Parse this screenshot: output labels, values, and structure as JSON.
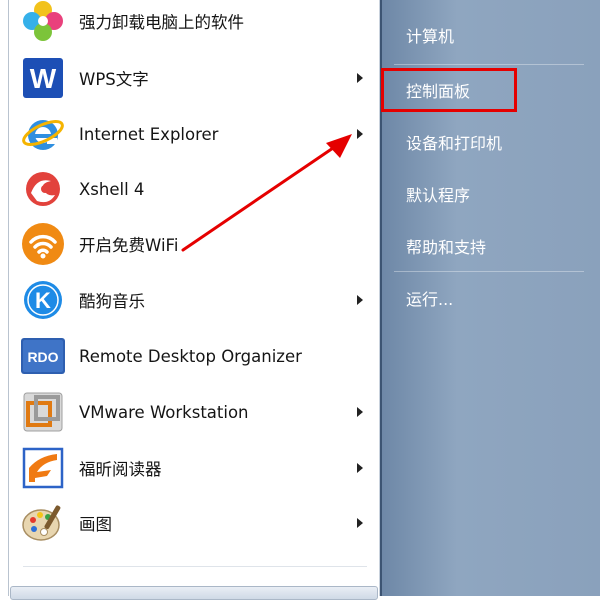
{
  "programs": [
    {
      "label": "强力卸载电脑上的软件",
      "icon": "uninstaller-icon",
      "has_submenu": false
    },
    {
      "label": "WPS文字",
      "icon": "wps-writer-icon",
      "has_submenu": true
    },
    {
      "label": "Internet Explorer",
      "icon": "internet-explorer-icon",
      "has_submenu": true
    },
    {
      "label": "Xshell 4",
      "icon": "xshell-icon",
      "has_submenu": false
    },
    {
      "label": "开启免费WiFi",
      "icon": "free-wifi-icon",
      "has_submenu": false
    },
    {
      "label": "酷狗音乐",
      "icon": "kugou-music-icon",
      "has_submenu": true
    },
    {
      "label": "Remote Desktop Organizer",
      "icon": "rdo-icon",
      "has_submenu": false
    },
    {
      "label": "VMware Workstation",
      "icon": "vmware-icon",
      "has_submenu": true
    },
    {
      "label": "福昕阅读器",
      "icon": "foxit-reader-icon",
      "has_submenu": true
    },
    {
      "label": "画图",
      "icon": "paint-icon",
      "has_submenu": true
    }
  ],
  "system_items": [
    {
      "label": "计算机"
    },
    {
      "label": "控制面板",
      "highlighted": true
    },
    {
      "label": "设备和打印机"
    },
    {
      "label": "默认程序"
    },
    {
      "label": "帮助和支持"
    },
    {
      "label": "运行..."
    }
  ],
  "colors": {
    "highlight": "#e50000",
    "right_pane": "#8aa1bc"
  }
}
